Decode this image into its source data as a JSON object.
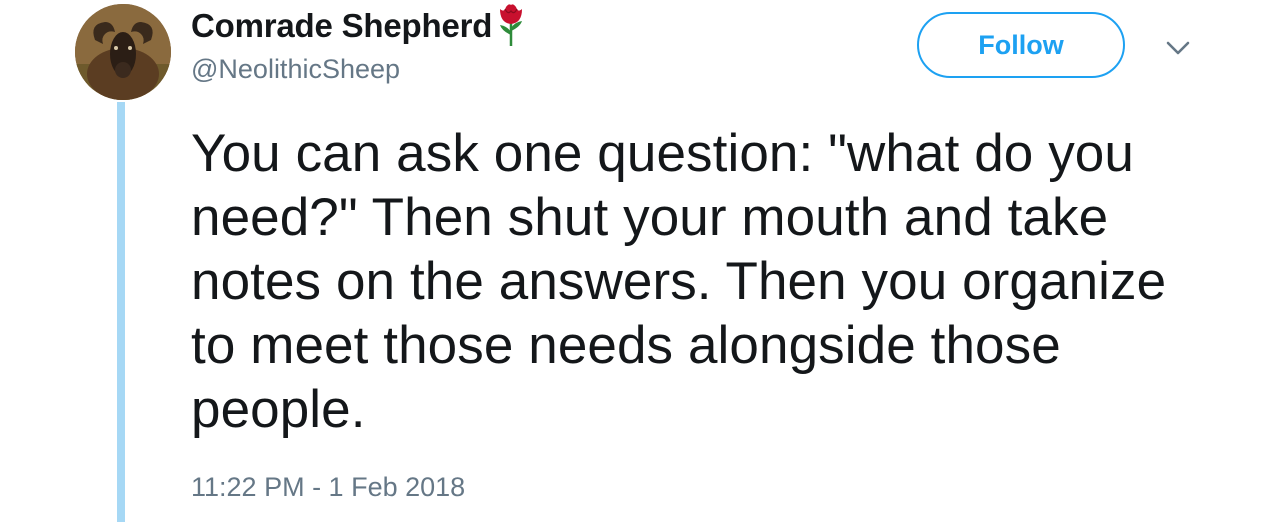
{
  "tweet": {
    "author": {
      "display_name": "Comrade Shepherd",
      "handle": "@NeolithicSheep",
      "avatar_icon": "sheep-avatar",
      "name_emoji_icon": "rose-icon"
    },
    "follow_label": "Follow",
    "more_icon": "chevron-down-icon",
    "text": "You can ask one question: \"what do you need?\" Then shut your mouth and take notes on the answers. Then you organize to meet those needs alongside those people.",
    "timestamp": "11:22 PM - 1 Feb 2018"
  },
  "colors": {
    "accent": "#1da1f2",
    "text_primary": "#14171a",
    "text_secondary": "#657786",
    "thread_line": "#a6d8f5",
    "rose": "#c8102e"
  }
}
